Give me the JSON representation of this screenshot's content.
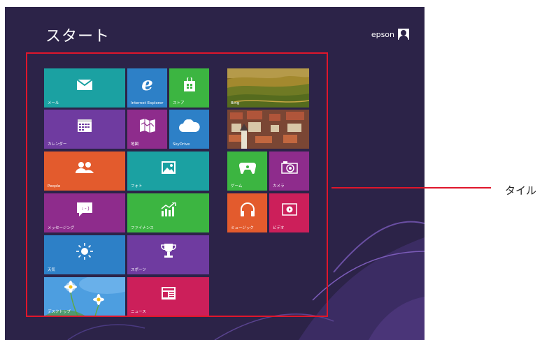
{
  "start_title": "スタート",
  "user_name": "epson",
  "callout_label": "タイル",
  "tiles": {
    "mail": {
      "label": "メール",
      "color": "#1ba1a2",
      "icon": "envelope-icon"
    },
    "ie": {
      "label": "Internet Explorer",
      "color": "#2d80c7",
      "icon": "ie-icon"
    },
    "store": {
      "label": "ストア",
      "color": "#3cb541",
      "icon": "store-bag-icon"
    },
    "calendar": {
      "label": "カレンダー",
      "color": "#6f3ba0",
      "icon": "calendar-icon"
    },
    "maps": {
      "label": "地図",
      "color": "#8e2c8c",
      "icon": "map-icon"
    },
    "skydrive": {
      "label": "SkyDrive",
      "color": "#2d80c7",
      "icon": "cloud-icon"
    },
    "people": {
      "label": "People",
      "color": "#e35b2d",
      "icon": "people-icon"
    },
    "photos": {
      "label": "フォト",
      "color": "#1ba1a2",
      "icon": "photo-icon"
    },
    "messaging": {
      "label": "メッセージング",
      "color": "#8e2c8c",
      "icon": "chat-bubble-icon"
    },
    "finance": {
      "label": "ファイナンス",
      "color": "#3cb541",
      "icon": "chart-up-icon"
    },
    "weather": {
      "label": "天気",
      "color": "#2d80c7",
      "icon": "sun-icon"
    },
    "sports": {
      "label": "スポーツ",
      "color": "#6f3ba0",
      "icon": "trophy-icon"
    },
    "desktop": {
      "label": "デスクトップ",
      "color": "#3a8bd0",
      "icon": "desktop-wallpaper-icon"
    },
    "news": {
      "label": "ニュース",
      "color": "#cc1f5a",
      "icon": "news-icon"
    },
    "bing": {
      "label": "Bing",
      "color": "#8a7a2a",
      "icon": "landscape-image"
    },
    "travel": {
      "label": "",
      "color": "#8b4a3a",
      "icon": "city-image"
    },
    "games": {
      "label": "ゲーム",
      "color": "#3cb541",
      "icon": "gamepad-icon"
    },
    "camera": {
      "label": "カメラ",
      "color": "#8e2c8c",
      "icon": "camera-icon"
    },
    "music": {
      "label": "ミュージック",
      "color": "#e35b2d",
      "icon": "headphones-icon"
    },
    "video": {
      "label": "ビデオ",
      "color": "#cc1f5a",
      "icon": "play-icon"
    }
  }
}
